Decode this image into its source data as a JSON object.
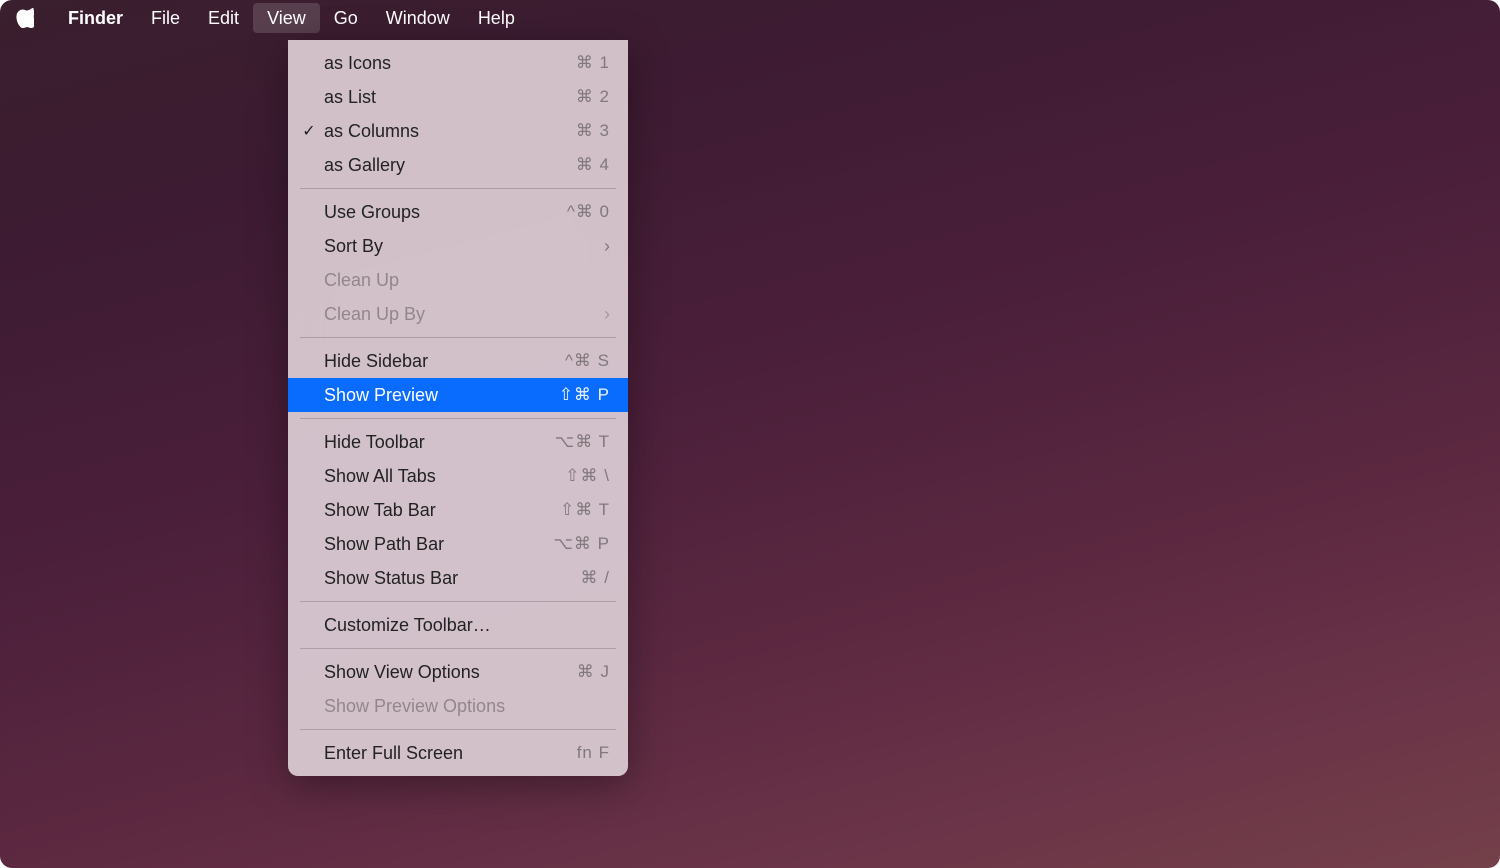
{
  "menubar": {
    "items": [
      "Finder",
      "File",
      "Edit",
      "View",
      "Go",
      "Window",
      "Help"
    ],
    "activeIndex": 3
  },
  "dropdown": {
    "groups": [
      [
        {
          "label": "as Icons",
          "shortcut": "⌘ 1",
          "checked": false
        },
        {
          "label": "as List",
          "shortcut": "⌘ 2",
          "checked": false
        },
        {
          "label": "as Columns",
          "shortcut": "⌘ 3",
          "checked": true
        },
        {
          "label": "as Gallery",
          "shortcut": "⌘ 4",
          "checked": false
        }
      ],
      [
        {
          "label": "Use Groups",
          "shortcut": "^⌘ 0"
        },
        {
          "label": "Sort By",
          "submenu": true
        },
        {
          "label": "Clean Up",
          "disabled": true
        },
        {
          "label": "Clean Up By",
          "disabled": true,
          "submenu": true
        }
      ],
      [
        {
          "label": "Hide Sidebar",
          "shortcut": "^⌘ S"
        },
        {
          "label": "Show Preview",
          "shortcut": "⇧⌘ P",
          "highlighted": true
        }
      ],
      [
        {
          "label": "Hide Toolbar",
          "shortcut": "⌥⌘ T"
        },
        {
          "label": "Show All Tabs",
          "shortcut": "⇧⌘ \\"
        },
        {
          "label": "Show Tab Bar",
          "shortcut": "⇧⌘ T"
        },
        {
          "label": "Show Path Bar",
          "shortcut": "⌥⌘ P"
        },
        {
          "label": "Show Status Bar",
          "shortcut": "⌘ /"
        }
      ],
      [
        {
          "label": "Customize Toolbar…"
        }
      ],
      [
        {
          "label": "Show View Options",
          "shortcut": "⌘ J"
        },
        {
          "label": "Show Preview Options",
          "disabled": true
        }
      ],
      [
        {
          "label": "Enter Full Screen",
          "shortcut": "fn F"
        }
      ]
    ]
  }
}
